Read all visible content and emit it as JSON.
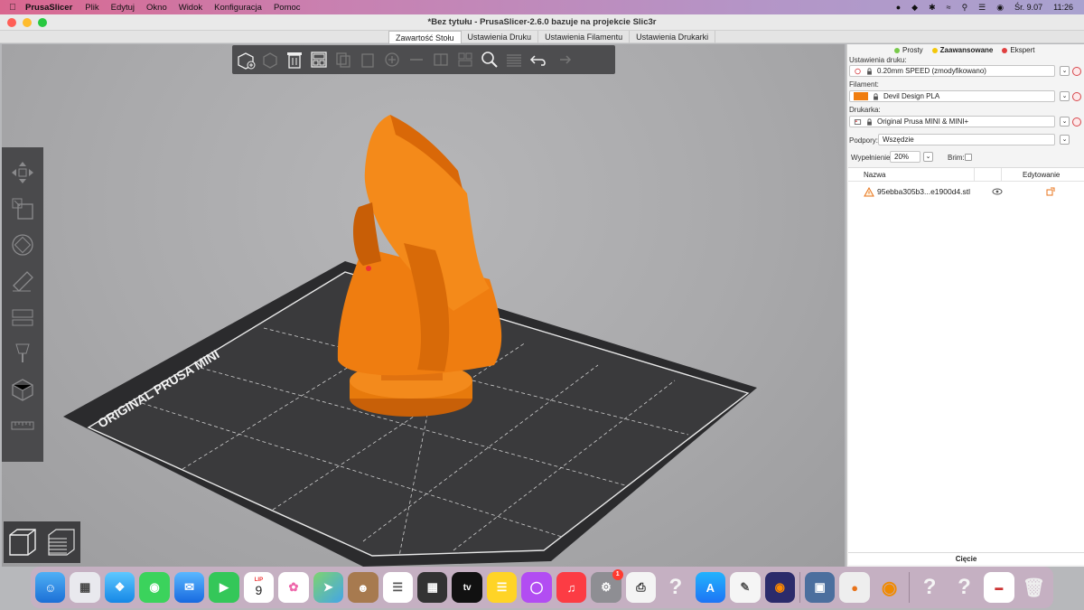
{
  "menubar": {
    "app": "PrusaSlicer",
    "items": [
      "Plik",
      "Edytuj",
      "Okno",
      "Widok",
      "Konfiguracja",
      "Pomoc"
    ],
    "clock_day": "Śr. 9.07",
    "clock_time": "11:26"
  },
  "window": {
    "title": "*Bez tytułu - PrusaSlicer-2.6.0 bazuje na projekcie Slic3r"
  },
  "tabs": [
    "Zawartość Stołu",
    "Ustawienia Druku",
    "Ustawienia Filamentu",
    "Ustawienia Drukarki"
  ],
  "viewport": {
    "bed_label": "ORIGINAL PRUSA MINI",
    "model_color": "#f07d0f"
  },
  "sidebar": {
    "modes": [
      {
        "label": "Prosty",
        "color": "#78c94a"
      },
      {
        "label": "Zaawansowane",
        "color": "#f3c70a"
      },
      {
        "label": "Ekspert",
        "color": "#e04040"
      }
    ],
    "print_settings_label": "Ustawienia druku:",
    "print_settings_value": "0.20mm SPEED (zmodyfikowano)",
    "filament_label": "Filament:",
    "filament_value": "Devil Design PLA",
    "filament_color": "#f07d0f",
    "printer_label": "Drukarka:",
    "printer_value": "Original Prusa MINI & MINI+",
    "supports_label": "Podpory:",
    "supports_value": "Wszędzie",
    "infill_label": "Wypełnienie:",
    "infill_value": "20%",
    "brim_label": "Brim:",
    "table": {
      "col_name": "Nazwa",
      "col_edit": "Edytowanie",
      "object_name": "95ebba305b3...e1900d4.stl"
    },
    "slice_button": "Cięcie"
  },
  "dock": {
    "calendar_month": "LIP",
    "calendar_day": "9",
    "badge_count": "1"
  }
}
